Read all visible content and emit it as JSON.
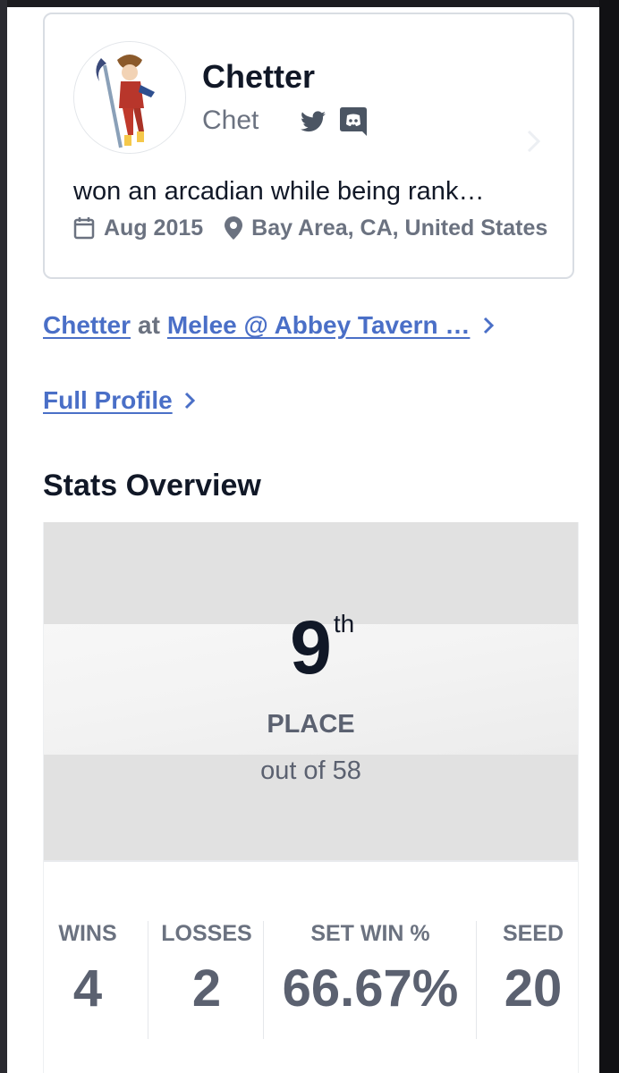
{
  "profile": {
    "name": "Chetter",
    "handle": "Chet",
    "bio": "won an arcadian while being rank…",
    "joined": "Aug 2015",
    "location": "Bay Area, CA, United States",
    "social": [
      "twitter-icon",
      "discord-icon"
    ]
  },
  "links": {
    "event_player": "Chetter",
    "event_at": "at",
    "event_name": "Melee @ Abbey Tavern …",
    "full_profile": "Full Profile"
  },
  "stats": {
    "title": "Stats Overview",
    "place_number": "9",
    "place_suffix": "th",
    "place_label": "PLACE",
    "place_out_of": "out of 58",
    "wins_label": "WINS",
    "wins_value": "4",
    "losses_label": "LOSSES",
    "losses_value": "2",
    "setwin_label": "SET WIN %",
    "setwin_value": "66.67%",
    "seed_label": "SEED",
    "seed_value": "20"
  },
  "colors": {
    "link": "#4a6fc7",
    "text_primary": "#111827",
    "text_muted": "#6b7280",
    "card_border": "#d9dde3",
    "placing_bg": "#e1e1e1"
  }
}
